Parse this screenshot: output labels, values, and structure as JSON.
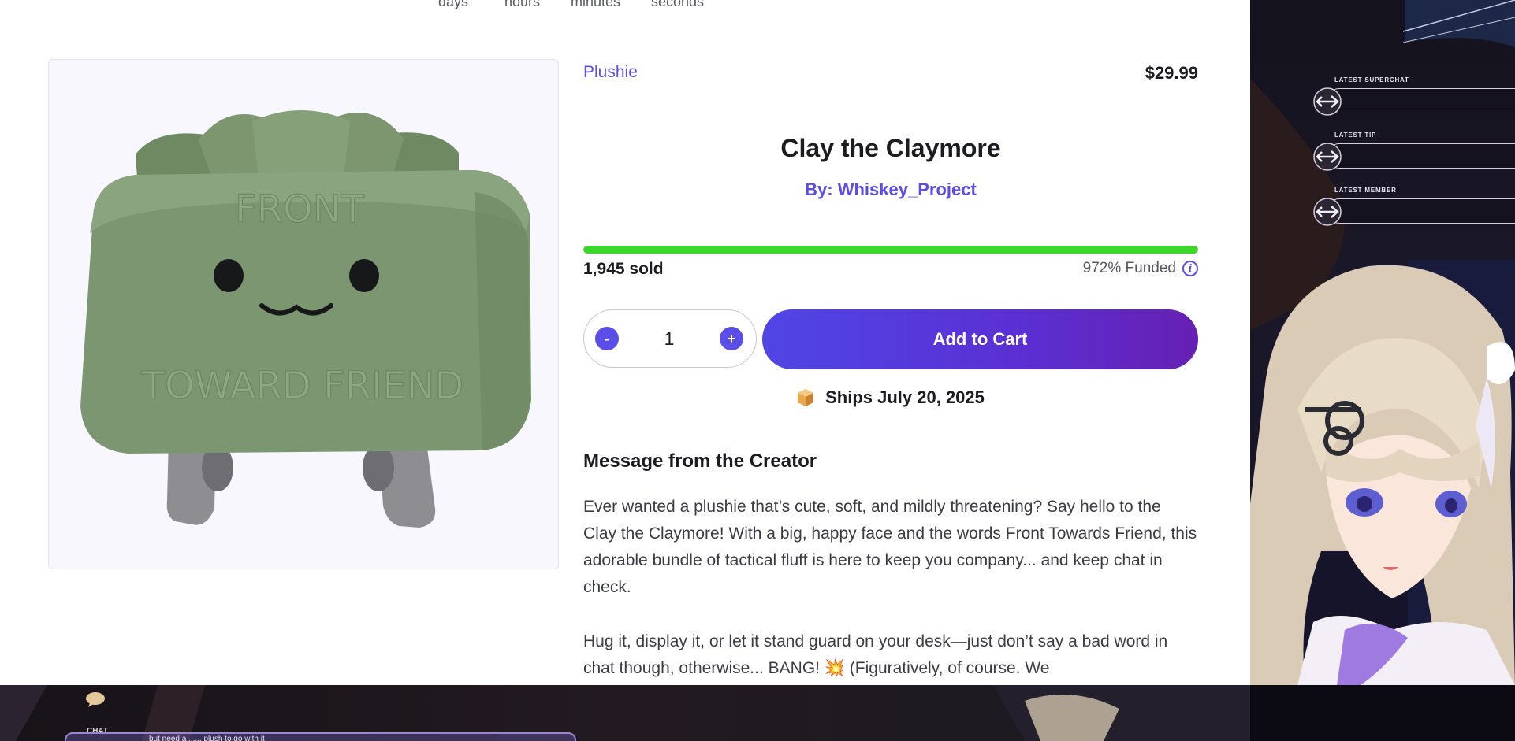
{
  "countdown": {
    "units": [
      "days",
      "hours",
      "minutes",
      "seconds"
    ]
  },
  "product": {
    "category": "Plushie",
    "price": "$29.99",
    "title": "Clay the Claymore",
    "creator_line": "By: Whiskey_Project",
    "image_text_top": "FRONT",
    "image_text_bottom": "TOWARD FRIEND"
  },
  "funding": {
    "sold": "1,945 sold",
    "funded": "972% Funded",
    "progress_fraction": 1.0
  },
  "cart": {
    "decrement_label": "-",
    "increment_label": "+",
    "quantity": "1",
    "add_to_cart_label": "Add to Cart"
  },
  "shipping": {
    "icon": "package-icon",
    "text": "Ships July 20, 2025"
  },
  "creator_message": {
    "heading": "Message from the Creator",
    "paragraph_1": "Ever wanted a plushie that’s cute, soft, and mildly threatening? Say hello to the Clay the Claymore! With a big, happy face and the words Front Towards Friend, this adorable bundle of tactical fluff is here to keep you company... and keep chat in check.",
    "paragraph_2": "Hug it, display it, or let it stand guard on your desk—just don’t say a bad word in chat though, otherwise... BANG! 💥 (Figuratively, of course. We"
  },
  "stream_overlay": {
    "alerts": [
      {
        "label": "LATEST SUPERCHAT",
        "value": ""
      },
      {
        "label": "LATEST TIP",
        "value": ""
      },
      {
        "label": "LATEST MEMBER",
        "value": ""
      }
    ],
    "chat_label": "CHAT",
    "chat_message": "but need a ...... plush to go with it"
  },
  "colors": {
    "accent": "#5a4de8",
    "progress": "#3dd62d",
    "cart_gradient_end": "#6620b2"
  }
}
